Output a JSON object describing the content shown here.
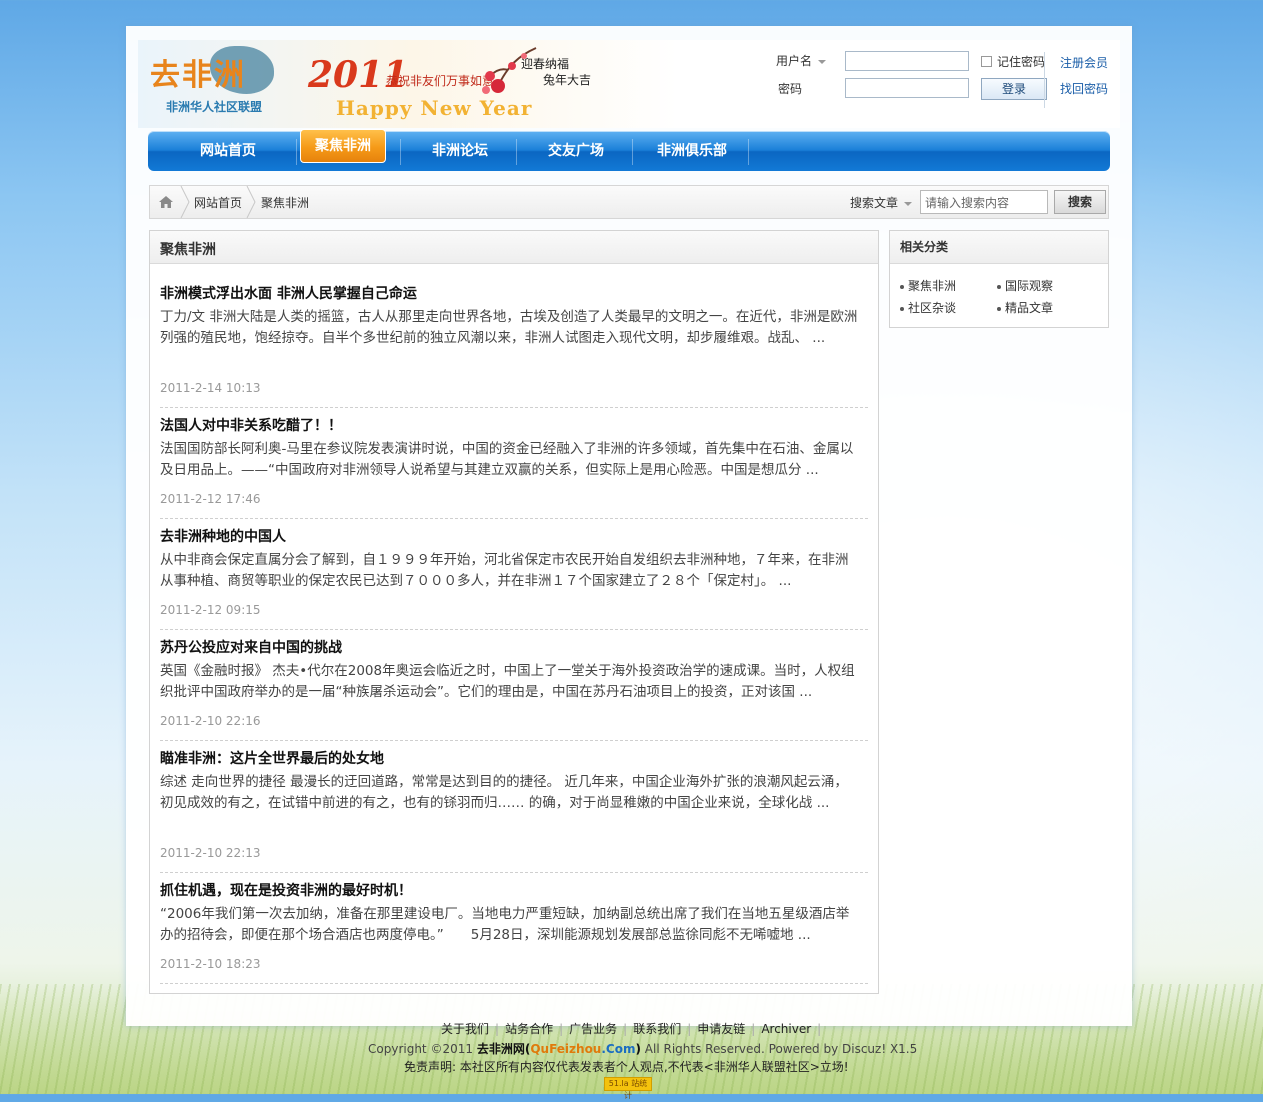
{
  "brand": {
    "logo_text": "去非洲",
    "logo_sub": "非洲华人社区联盟",
    "banner_year": "2011",
    "banner_wish": "恭祝非友们万事如意",
    "banner_hny": "Happy New Year",
    "banner_spring_1": "迎春纳福",
    "banner_spring_2": "兔年大吉"
  },
  "login": {
    "username_label": "用户名",
    "password_label": "密码",
    "remember_label": "记住密码",
    "login_button": "登录",
    "register_link": "注册会员",
    "recover_link": "找回密码"
  },
  "nav": {
    "items": [
      "网站首页",
      "聚焦非洲",
      "非洲论坛",
      "交友广场",
      "非洲俱乐部"
    ],
    "active_index": 1
  },
  "breadcrumb": {
    "items": [
      "网站首页",
      "聚焦非洲"
    ]
  },
  "search": {
    "type_label": "搜索文章",
    "placeholder": "请输入搜索内容",
    "button": "搜索"
  },
  "main": {
    "title": "聚焦非洲",
    "articles": [
      {
        "title": "非洲模式浮出水面 非洲人民掌握自己命运",
        "body": "丁力/文 非洲大陆是人类的摇篮，古人从那里走向世界各地，古埃及创造了人类最早的文明之一。在近代，非洲是欧洲列强的殖民地，饱经掠夺。自半个多世纪前的独立风潮以来，非洲人试图走入现代文明，却步履维艰。战乱、 ...",
        "date": "2011-2-14 10:13"
      },
      {
        "title": "法国人对中非关系吃醋了！！",
        "body": "法国国防部长阿利奥-马里在参议院发表演讲时说，中国的资金已经融入了非洲的许多领域，首先集中在石油、金属以及日用品上。——“中国政府对非洲领导人说希望与其建立双赢的关系，但实际上是用心险恶。中国是想瓜分 ...",
        "date": "2011-2-12 17:46"
      },
      {
        "title": "去非洲种地的中国人",
        "body": "从中非商会保定直属分会了解到，自１９９９年开始，河北省保定市农民开始自发组织去非洲种地，７年来，在非洲从事种植、商贸等职业的保定农民已达到７０００多人，并在非洲１７个国家建立了２８个「保定村」。 ...",
        "date": "2011-2-12 09:15"
      },
      {
        "title": "苏丹公投应对来自中国的挑战",
        "body": "英国《金融时报》 杰夫•代尔在2008年奥运会临近之时，中国上了一堂关于海外投资政治学的速成课。当时，人权组织批评中国政府举办的是一届“种族屠杀运动会”。它们的理由是，中国在苏丹石油项目上的投资，正对该国 ...",
        "date": "2011-2-10 22:16"
      },
      {
        "title": "瞄准非洲：这片全世界最后的处女地",
        "body": "综述 走向世界的捷径 最漫长的迂回道路，常常是达到目的的捷径。 近几年来，中国企业海外扩张的浪潮风起云涌，初见成效的有之，在试错中前进的有之，也有的铩羽而归…… 的确，对于尚显稚嫩的中国企业来说，全球化战 ...",
        "date": "2011-2-10 22:13"
      },
      {
        "title": "抓住机遇，现在是投资非洲的最好时机！",
        "body": "“2006年我们第一次去加纳，准备在那里建设电厂。当地电力严重短缺，加纳副总统出席了我们在当地五星级酒店举办的招待会，即便在那个场合酒店也两度停电。”　　5月28日，深圳能源规划发展部总监徐同彪不无唏嘘地 ...",
        "date": "2011-2-10 18:23"
      }
    ]
  },
  "sidebar": {
    "title": "相关分类",
    "items": [
      "聚焦非洲",
      "国际观察",
      "社区杂谈",
      "精品文章"
    ]
  },
  "footer": {
    "links": [
      "关于我们",
      "站务合作",
      "广告业务",
      "联系我们",
      "申请友链",
      "Archiver"
    ],
    "copy_prefix": "Copyright ©2011",
    "site_name": "去非洲网",
    "paren_open": "(",
    "domain_qu": "QuFeizhou",
    "domain_com": ".Com",
    "paren_close": ")",
    "copy_suffix": "All Rights Reserved. Powered by Discuz! X1.5",
    "disclaimer": "免责声明: 本社区所有内容仅代表发表者个人观点,不代表<非洲华人联盟社区>立场!",
    "badge": "51.la 站统计"
  }
}
